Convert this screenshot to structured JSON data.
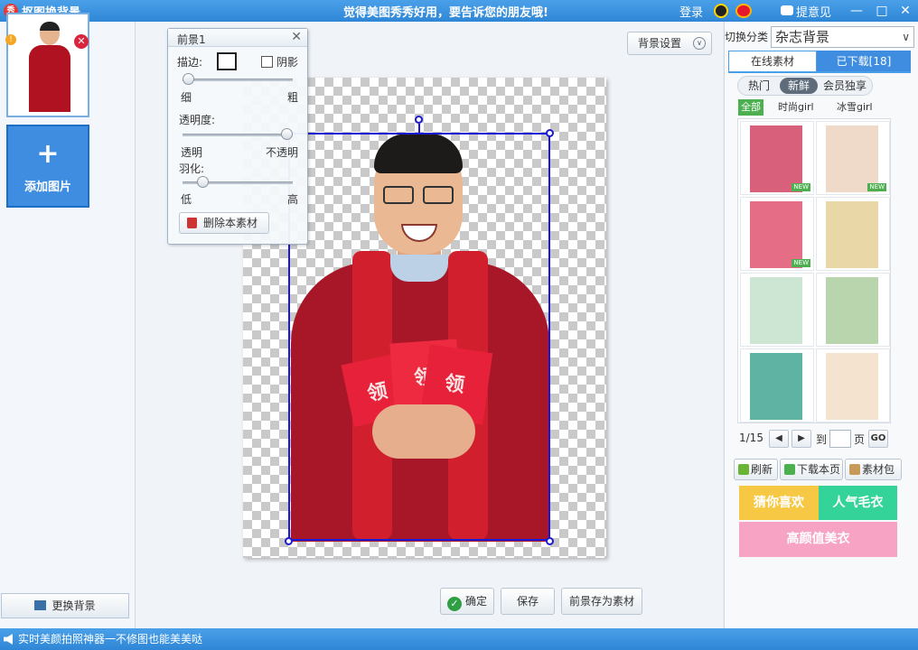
{
  "titlebar": {
    "app_icon": "秀",
    "title": "抠图换背景",
    "slogan": "觉得美图秀秀好用，要告诉您的朋友哦!",
    "login": "登录",
    "feedback": "提意见",
    "minimize": "—",
    "maximize": "□",
    "close": "✕",
    "icons": [
      "qq-icon",
      "weibo-icon",
      "feedback-icon"
    ]
  },
  "left_panel": {
    "thumb_badge": "!",
    "thumb_close": "✕",
    "add_plus": "+",
    "add_label": "添加图片",
    "change_bg": "更换背景"
  },
  "toolbar": {
    "bg_setting": "背景设置",
    "bg_setting_chevron": "∨"
  },
  "popup": {
    "title": "前景1",
    "close": "✕",
    "stroke_label": "描边:",
    "shadow_label": "阴影",
    "thin": "细",
    "thick": "粗",
    "opacity_label": "透明度:",
    "transparent": "透明",
    "opaque": "不透明",
    "feather_label": "羽化:",
    "low": "低",
    "high": "高",
    "delete_label": "删除本素材",
    "stroke_level": 0,
    "opacity_level": 1.0,
    "feather_level": 0.15
  },
  "canvas": {
    "envelope_text": [
      "领",
      "领",
      "领"
    ]
  },
  "actions": {
    "ok": "确定",
    "save": "保存",
    "save_as_material": "前景存为素材"
  },
  "right_panel": {
    "switch_label": "切换分类",
    "category": "杂志背景",
    "category_arrow": "∨",
    "tab_online": "在线素材",
    "tab_downloaded": "已下载[18]",
    "subtabs": [
      "热门",
      "新鲜",
      "会员独享"
    ],
    "active_subtab": "新鲜",
    "filters": [
      "全部",
      "时尚girl",
      "冰雪girl"
    ],
    "new_tag": "NEW",
    "page": "1/15",
    "prev": "◀",
    "next": "▶",
    "goto_label": "到",
    "page_unit": "页",
    "go": "GO",
    "refresh": "刷新",
    "download_page": "下载本页",
    "material_pack": "素材包",
    "banner_guess": "猜你喜欢",
    "banner_popular": "人气毛衣",
    "banner_high": "高颜值美衣",
    "colors": {
      "banner_guess": "#f7c843",
      "banner_popular": "#34d399",
      "banner_high": "#f7a4c4"
    }
  },
  "statusbar": {
    "text": "实时美颜拍照神器一不修图也能美美哒"
  }
}
